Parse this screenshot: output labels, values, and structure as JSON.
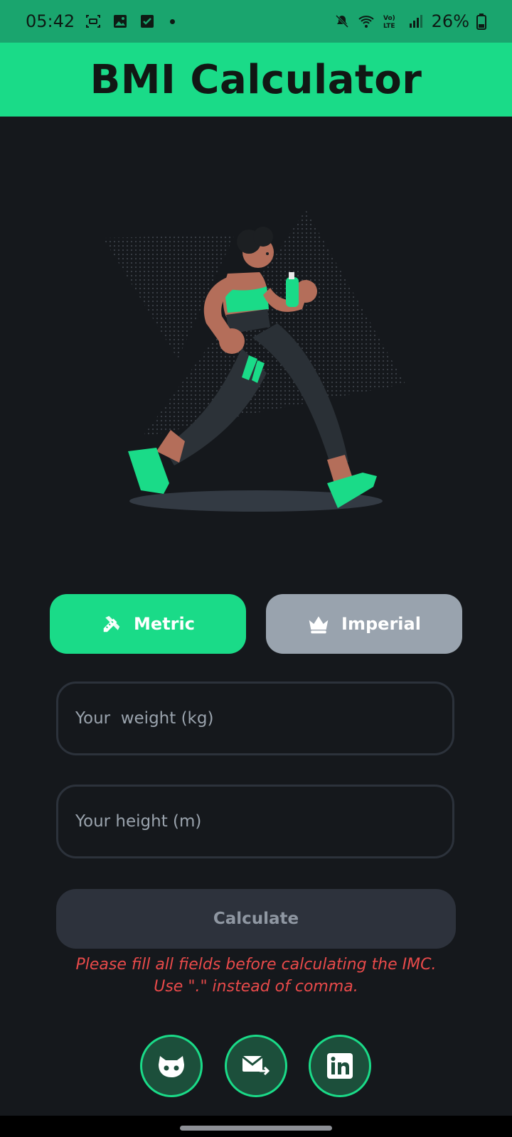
{
  "status_bar": {
    "time": "05:42",
    "battery": "26%",
    "left_icons": [
      "screen-record-icon",
      "image-icon",
      "check-icon",
      "dot"
    ],
    "right_icons": [
      "mute-icon",
      "wifi-icon",
      "volte-icon",
      "signal-icon",
      "battery-icon"
    ]
  },
  "app": {
    "title": "BMI Calculator"
  },
  "units": {
    "metric_label": "Metric",
    "imperial_label": "Imperial",
    "metric_icon": "ruler-pencil-icon",
    "imperial_icon": "crown-icon",
    "selected": "Metric"
  },
  "form": {
    "weight_placeholder": "Your  weight (kg)",
    "height_placeholder": "Your height (m)",
    "calculate_label": "Calculate",
    "error_message": "Please fill all fields before calculating the IMC. Use \".\" instead of comma."
  },
  "social": [
    "github-icon",
    "mail-forward-icon",
    "linkedin-icon"
  ],
  "colors": {
    "accent": "#1adb88",
    "background": "#15181c",
    "inactive_button": "#99a3ae",
    "error": "#e84a4a",
    "status_bar": "#1aa56e"
  }
}
